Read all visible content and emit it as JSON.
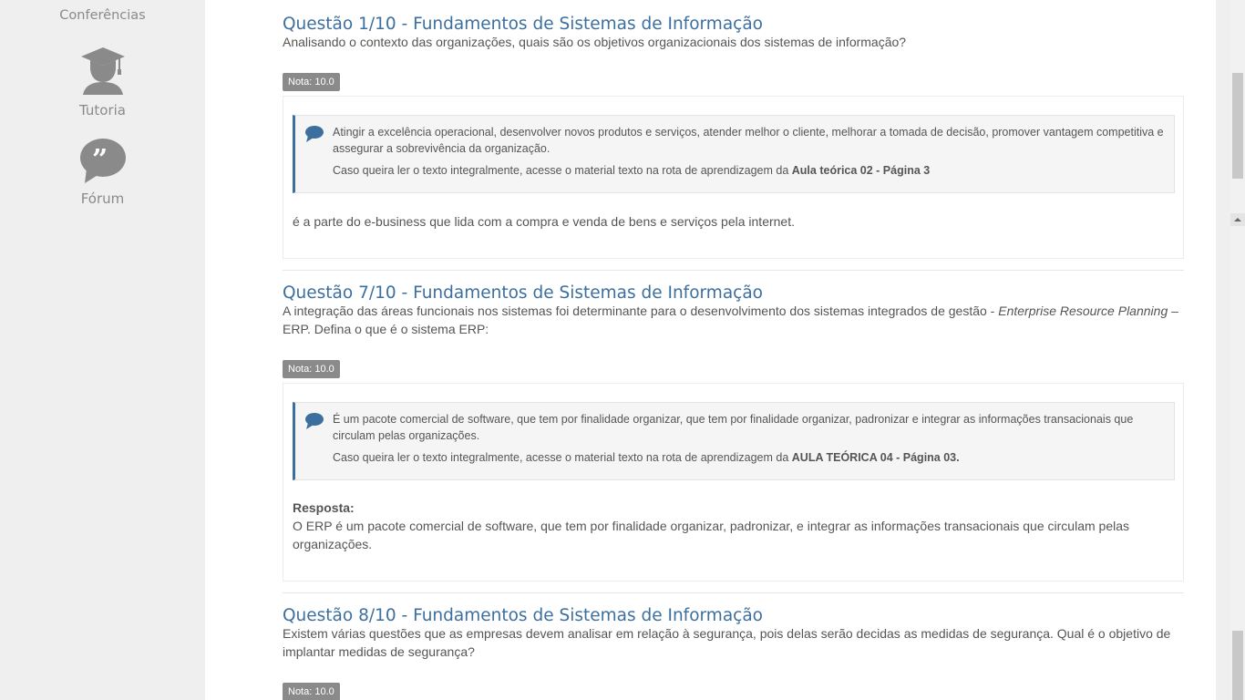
{
  "sidebar": {
    "items": [
      {
        "label": "Conferências",
        "icon": "conference-icon"
      },
      {
        "label": "Tutoria",
        "icon": "graduation-cap-icon"
      },
      {
        "label": "Fórum",
        "icon": "quote-bubble-icon"
      }
    ]
  },
  "questions": [
    {
      "title": "Questão 1/10 - Fundamentos de Sistemas de Informação",
      "text": "Analisando o contexto das organizações, quais são os objetivos organizacionais dos sistemas de informação?",
      "grade": "Nota: 10.0",
      "feedback_line1": "Atingir a excelência operacional, desenvolver novos produtos e serviços, atender melhor o cliente, melhorar a tomada de decisão, promover vantagem competitiva e assegurar a sobrevivência da organização.",
      "feedback_line2_prefix": "Caso queira ler o texto integralmente, acesse o material texto na rota de aprendizagem da ",
      "feedback_line2_bold": "Aula teórica 02 -  Página 3",
      "answer": "é a parte do e-business que lida com a compra e venda de bens e serviços pela internet."
    },
    {
      "title": "Questão 7/10 - Fundamentos de Sistemas de Informação",
      "text_prefix": "A integração das áreas funcionais nos sistemas foi determinante para o desenvolvimento dos sistemas integrados de gestão - ",
      "text_italic": "Enterprise Resource Planning",
      "text_suffix": " – ERP. Defina o que é o sistema ERP:",
      "grade": "Nota: 10.0",
      "feedback_line1": "É um pacote comercial de software, que tem por finalidade organizar, que tem por finalidade organizar, padronizar e integrar as informações transacionais que circulam pelas organizações.",
      "feedback_line2_prefix": "Caso queira ler o texto integralmente, acesse o material texto na rota de aprendizagem da ",
      "feedback_line2_bold": "AULA TEÓRICA 04 - Página 03.",
      "answer_label": "Resposta:",
      "answer": "O ERP é um pacote comercial de software, que tem por finalidade organizar, padronizar, e integrar as informações transacionais que circulam pelas organizações."
    },
    {
      "title": "Questão 8/10 - Fundamentos de Sistemas de Informação",
      "text": "Existem várias questões que as empresas devem analisar em relação à segurança, pois delas serão decidas as medidas de segurança. Qual é o objetivo de implantar medidas de segurança?",
      "grade": "Nota: 10.0"
    }
  ]
}
